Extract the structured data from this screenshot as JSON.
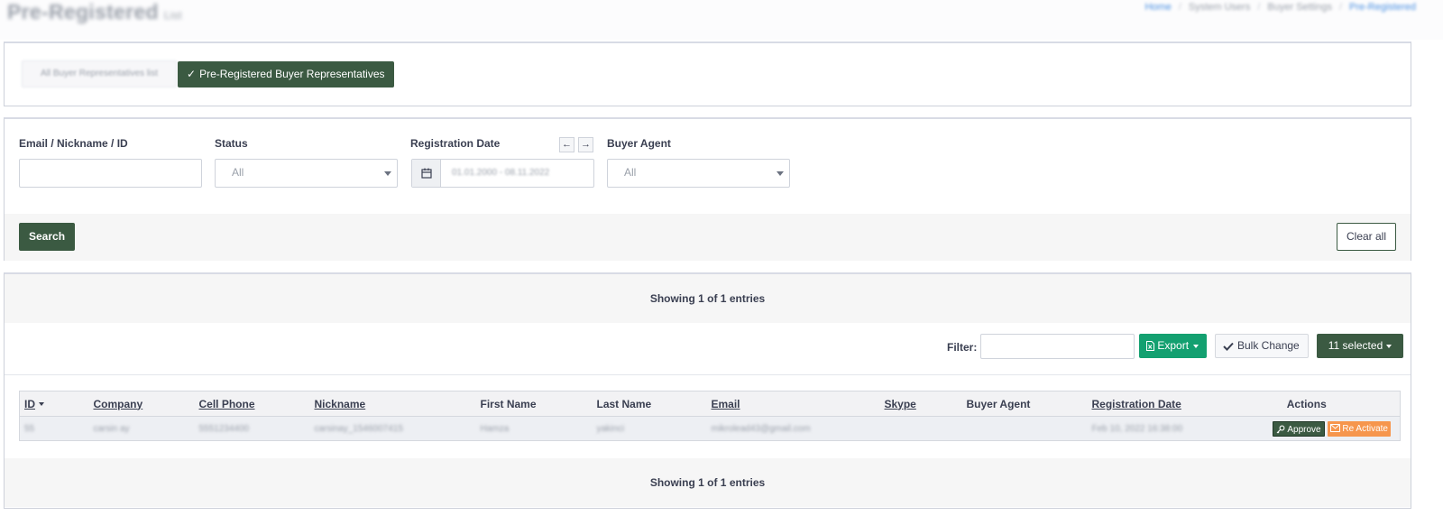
{
  "header": {
    "title": "Pre-Registered",
    "title_sub": "List",
    "breadcrumb": [
      "Home",
      "System Users",
      "Buyer Settings",
      "Pre-Registered"
    ]
  },
  "tabs": [
    {
      "label": "All Buyer Representatives list",
      "active": false
    },
    {
      "label": "Pre-Registered Buyer Representatives",
      "active": true
    }
  ],
  "search": {
    "email_label": "Email / Nickname / ID",
    "email_value": "",
    "status_label": "Status",
    "status_value": "All",
    "date_label": "Registration Date",
    "date_value": "01.01.2000 - 08.11.2022",
    "agent_label": "Buyer Agent",
    "agent_value": "All",
    "search_button": "Search",
    "clear_button": "Clear all"
  },
  "results": {
    "showing_text": "Showing 1 of 1 entries",
    "filter_label": "Filter:",
    "export_label": "Export",
    "bulk_label": "Bulk Change",
    "selected_label": "11 selected",
    "columns": [
      "ID",
      "Company",
      "Cell Phone",
      "Nickname",
      "First Name",
      "Last Name",
      "Email",
      "Skype",
      "Buyer Agent",
      "Registration Date",
      "Actions"
    ],
    "rows": [
      {
        "id": "55",
        "company": "carsin ay",
        "cell_phone": "5551234400",
        "nickname": "carsinay_1546007415",
        "first_name": "Hamza",
        "last_name": "yakinci",
        "email": "mikrolead43@gmail.com",
        "skype": "",
        "buyer_agent": "",
        "registration_date": "Feb 10, 2022 16:38:00",
        "approve_label": "Approve",
        "reactivate_label": "Re Activate"
      }
    ]
  },
  "colors": {
    "primary": "#3b5a42",
    "export": "#13a070",
    "reactivate": "#f6964d"
  }
}
